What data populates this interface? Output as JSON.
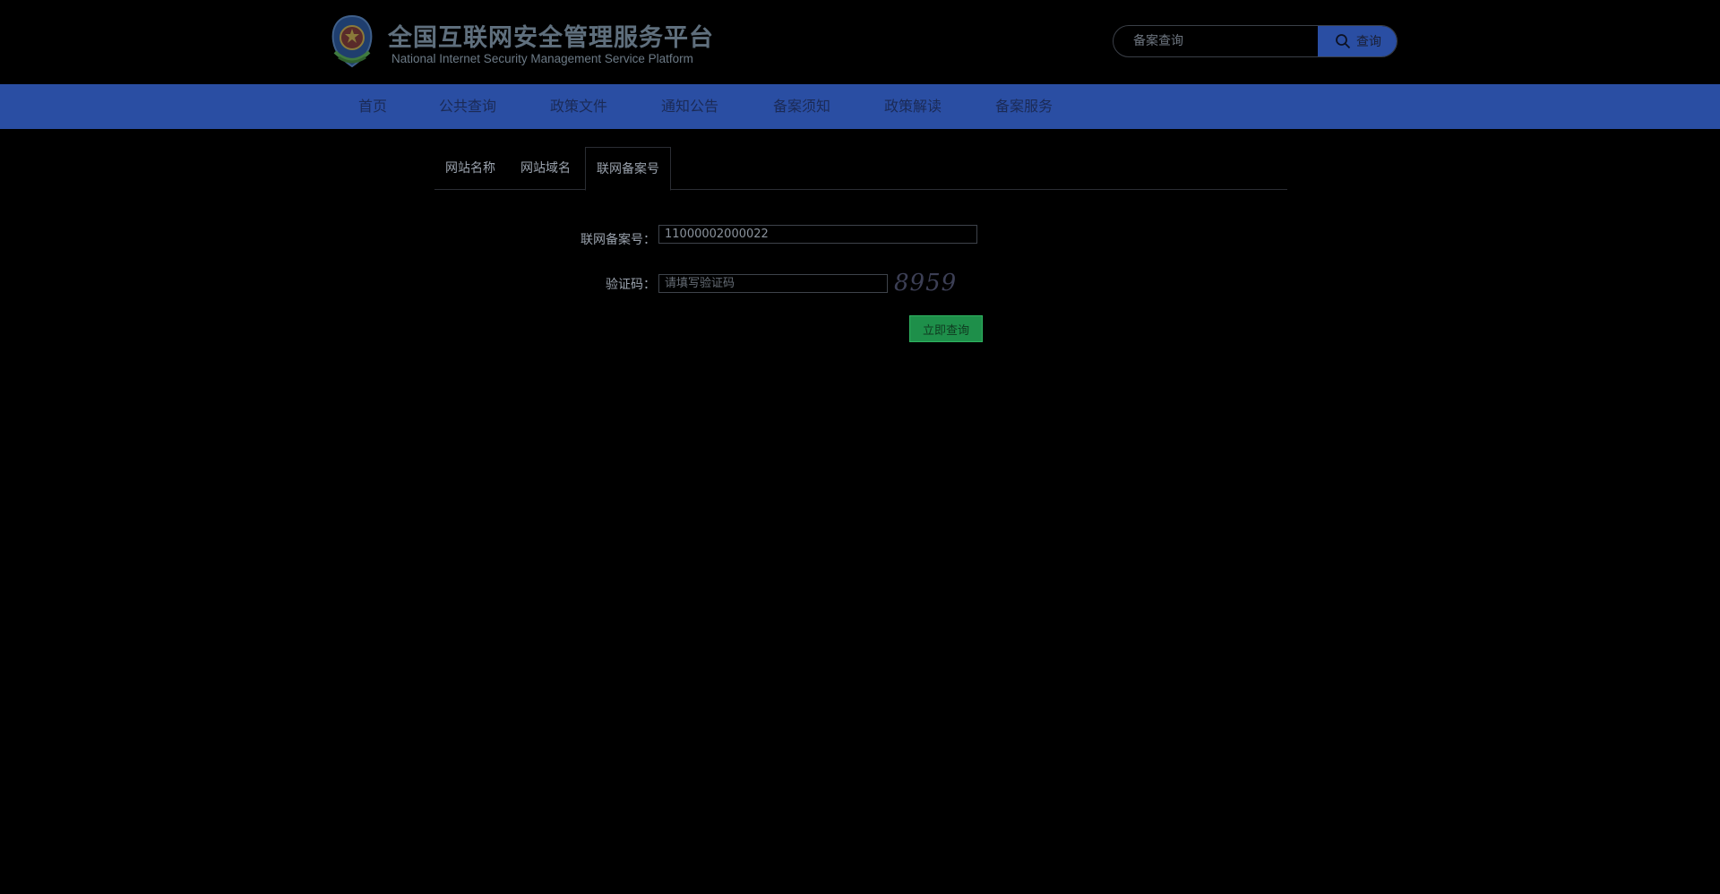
{
  "header": {
    "title": "全国互联网安全管理服务平台",
    "subtitle": "National Internet Security Management Service Platform",
    "search": {
      "placeholder": "备案查询",
      "button_label": "查询"
    }
  },
  "nav": {
    "items": [
      {
        "label": "首页"
      },
      {
        "label": "公共查询"
      },
      {
        "label": "政策文件"
      },
      {
        "label": "通知公告"
      },
      {
        "label": "备案须知"
      },
      {
        "label": "政策解读"
      },
      {
        "label": "备案服务"
      }
    ]
  },
  "tabs": [
    {
      "label": "网站名称"
    },
    {
      "label": "网站域名"
    },
    {
      "label": "联网备案号"
    }
  ],
  "form": {
    "record_label": "联网备案号：",
    "record_value": "11000002000022",
    "captcha_label": "验证码：",
    "captcha_placeholder": "请填写验证码",
    "captcha_text": "8959",
    "submit_label": "立即查询"
  },
  "colors": {
    "nav_bg": "#2a4ea3",
    "submit_bg": "#1e8f4a",
    "page_bg": "#000000"
  },
  "icons": {
    "emblem": "police-emblem-icon",
    "search": "search-icon"
  }
}
